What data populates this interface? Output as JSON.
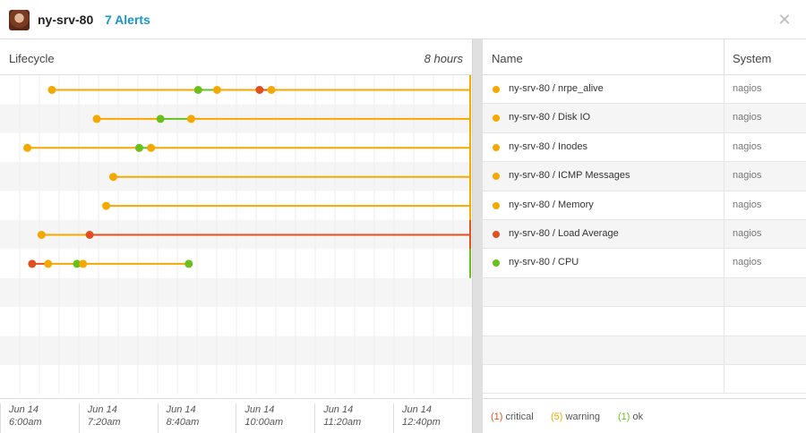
{
  "header": {
    "host": "ny-srv-80",
    "alerts": "7 Alerts",
    "close_glyph": "✕"
  },
  "timeline": {
    "title": "Lifecycle",
    "range_label": "8 hours",
    "ticks": [
      {
        "date": "Jun 14",
        "time": "6:00am"
      },
      {
        "date": "Jun 14",
        "time": "7:20am"
      },
      {
        "date": "Jun 14",
        "time": "8:40am"
      },
      {
        "date": "Jun 14",
        "time": "10:00am"
      },
      {
        "date": "Jun 14",
        "time": "11:20am"
      },
      {
        "date": "Jun 14",
        "time": "12:40pm"
      }
    ]
  },
  "table": {
    "col_name": "Name",
    "col_system": "System"
  },
  "colors": {
    "critical": "#e0501e",
    "warning": "#f5a800",
    "ok": "#6bbf1c"
  },
  "alerts": [
    {
      "name": "ny-srv-80 / nrpe_alive",
      "system": "nagios",
      "status": "warning",
      "events": [
        {
          "t": 0.11,
          "s": "warning"
        },
        {
          "t": 0.42,
          "s": "ok"
        },
        {
          "t": 0.46,
          "s": "warning"
        },
        {
          "t": 0.55,
          "s": "critical"
        },
        {
          "t": 0.575,
          "s": "warning"
        }
      ]
    },
    {
      "name": "ny-srv-80 / Disk IO",
      "system": "nagios",
      "status": "warning",
      "events": [
        {
          "t": 0.205,
          "s": "warning"
        },
        {
          "t": 0.34,
          "s": "ok"
        },
        {
          "t": 0.405,
          "s": "warning"
        }
      ]
    },
    {
      "name": "ny-srv-80 / Inodes",
      "system": "nagios",
      "status": "warning",
      "events": [
        {
          "t": 0.058,
          "s": "warning"
        },
        {
          "t": 0.295,
          "s": "ok"
        },
        {
          "t": 0.32,
          "s": "warning"
        }
      ]
    },
    {
      "name": "ny-srv-80 / ICMP Messages",
      "system": "nagios",
      "status": "warning",
      "events": [
        {
          "t": 0.24,
          "s": "warning"
        }
      ]
    },
    {
      "name": "ny-srv-80 / Memory",
      "system": "nagios",
      "status": "warning",
      "events": [
        {
          "t": 0.225,
          "s": "warning"
        }
      ]
    },
    {
      "name": "ny-srv-80 / Load Average",
      "system": "nagios",
      "status": "critical",
      "events": [
        {
          "t": 0.088,
          "s": "warning"
        },
        {
          "t": 0.19,
          "s": "critical"
        }
      ]
    },
    {
      "name": "ny-srv-80 / CPU",
      "system": "nagios",
      "status": "ok",
      "events": [
        {
          "t": 0.068,
          "s": "critical"
        },
        {
          "t": 0.102,
          "s": "warning"
        },
        {
          "t": 0.163,
          "s": "ok"
        },
        {
          "t": 0.176,
          "s": "warning"
        },
        {
          "t": 0.4,
          "s": "ok"
        }
      ]
    }
  ],
  "legend": [
    {
      "count": "(1)",
      "label": "critical",
      "status": "critical"
    },
    {
      "count": "(5)",
      "label": "warning",
      "status": "warning"
    },
    {
      "count": "(1)",
      "label": "ok",
      "status": "ok"
    }
  ]
}
